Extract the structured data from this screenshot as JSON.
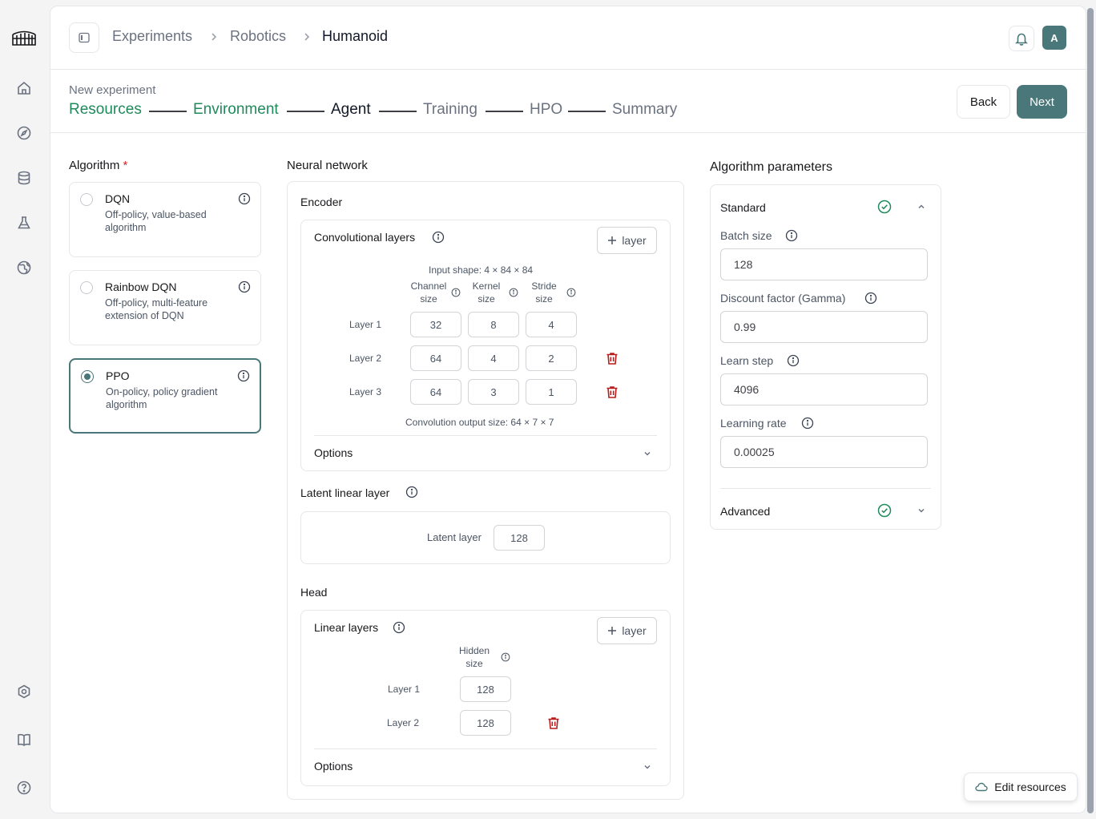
{
  "breadcrumb": [
    "Experiments",
    "Robotics",
    "Humanoid"
  ],
  "wizard": {
    "caption": "New experiment",
    "steps": [
      "Resources",
      "Environment",
      "Agent",
      "Training",
      "HPO",
      "Summary"
    ],
    "back_label": "Back",
    "next_label": "Next"
  },
  "avatar_initial": "A",
  "algorithm": {
    "title": "Algorithm",
    "required_mark": "*",
    "selected": "PPO",
    "options": [
      {
        "name": "DQN",
        "description": "Off-policy, value-based algorithm"
      },
      {
        "name": "Rainbow DQN",
        "description": "Off-policy, multi-feature extension of DQN"
      },
      {
        "name": "PPO",
        "description": "On-policy, policy gradient algorithm"
      }
    ]
  },
  "network": {
    "title": "Neural network",
    "encoder": {
      "title": "Encoder",
      "conv_title": "Convolutional layers",
      "add_label": "layer",
      "input_shape": "Input shape: 4 × 84 × 84",
      "columns": [
        "Channel size",
        "Kernel size",
        "Stride size"
      ],
      "rows": [
        {
          "label": "Layer 1",
          "values": [
            "32",
            "8",
            "4"
          ]
        },
        {
          "label": "Layer 2",
          "values": [
            "64",
            "4",
            "2"
          ]
        },
        {
          "label": "Layer 3",
          "values": [
            "64",
            "3",
            "1"
          ]
        }
      ],
      "output_size": "Convolution output size: 64 × 7 × 7",
      "options_label": "Options"
    },
    "latent": {
      "title": "Latent linear layer",
      "label": "Latent layer",
      "value": "128"
    },
    "head": {
      "title": "Head",
      "linear_title": "Linear layers",
      "add_label": "layer",
      "column": "Hidden size",
      "rows": [
        {
          "label": "Layer 1",
          "value": "128"
        },
        {
          "label": "Layer 2",
          "value": "128"
        }
      ],
      "options_label": "Options"
    }
  },
  "params": {
    "title": "Algorithm parameters",
    "standard_label": "Standard",
    "advanced_label": "Advanced",
    "fields": [
      {
        "label": "Batch size",
        "value": "128"
      },
      {
        "label": "Discount factor (Gamma)",
        "value": "0.99"
      },
      {
        "label": "Learn step",
        "value": "4096"
      },
      {
        "label": "Learning rate",
        "value": "0.00025"
      }
    ]
  },
  "edit_resources_label": "Edit resources",
  "colors": {
    "accent": "#4a7779",
    "success": "#1f8a5b",
    "danger": "#b91c1c"
  }
}
